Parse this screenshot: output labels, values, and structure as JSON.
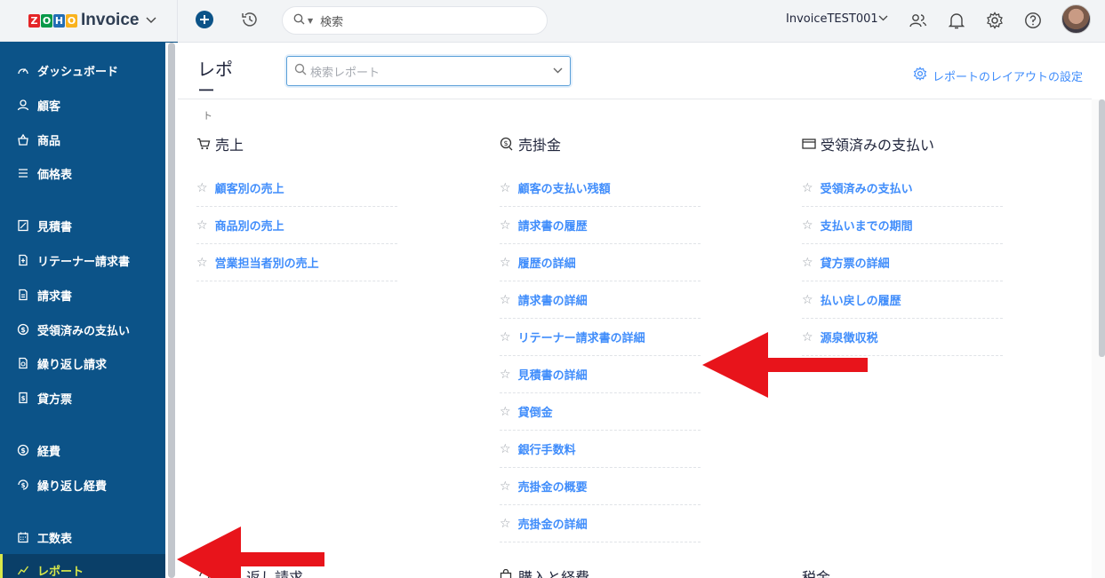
{
  "app": {
    "logo_text": "ZOHO",
    "logo_letters": [
      "Z",
      "O",
      "H",
      "O"
    ],
    "logo_colors": [
      "#e42527",
      "#089949",
      "#226db4",
      "#f9b21d"
    ],
    "name": "Invoice"
  },
  "sidebar": {
    "items": [
      {
        "label": "ダッシュボード",
        "icon": "dashboard-icon"
      },
      {
        "label": "顧客",
        "icon": "customer-icon"
      },
      {
        "label": "商品",
        "icon": "items-icon"
      },
      {
        "label": "価格表",
        "icon": "price-list-icon"
      },
      {
        "label": "見積書",
        "icon": "estimate-icon"
      },
      {
        "label": "リテーナー請求書",
        "icon": "retainer-invoice-icon"
      },
      {
        "label": "請求書",
        "icon": "invoice-icon"
      },
      {
        "label": "受領済みの支払い",
        "icon": "payments-received-icon"
      },
      {
        "label": "繰り返し請求",
        "icon": "recurring-invoice-icon"
      },
      {
        "label": "貸方票",
        "icon": "credit-note-icon"
      },
      {
        "label": "経費",
        "icon": "expense-icon"
      },
      {
        "label": "繰り返し経費",
        "icon": "recurring-expense-icon"
      },
      {
        "label": "工数表",
        "icon": "timesheet-icon"
      },
      {
        "label": "レポート",
        "icon": "reports-icon",
        "active": true
      }
    ],
    "active_color": "#d9e84a",
    "bg_color": "#0c5388"
  },
  "header": {
    "search_placeholder": "検索",
    "org_name": "InvoiceTEST001"
  },
  "main": {
    "title": "レポー",
    "title_tail": "ト",
    "report_search_placeholder": "検索レポート",
    "layout_settings_label": "レポートのレイアウトの設定",
    "link_color": "#408dfb",
    "sections": [
      {
        "title": "売上",
        "icon": "cart-icon",
        "items": [
          "顧客別の売上",
          "商品別の売上",
          "営業担当者別の売上"
        ]
      },
      {
        "title": "売掛金",
        "icon": "receivables-icon",
        "items": [
          "顧客の支払い残額",
          "請求書の履歴",
          "履歴の詳細",
          "請求書の詳細",
          "リテーナー請求書の詳細",
          "見積書の詳細",
          "貸倒金",
          "銀行手数料",
          "売掛金の概要",
          "売掛金の詳細"
        ]
      },
      {
        "title": "受領済みの支払い",
        "icon": "card-icon",
        "items": [
          "受領済みの支払い",
          "支払いまでの期間",
          "貸方票の詳細",
          "払い戻しの履歴",
          "源泉徴収税"
        ]
      }
    ],
    "bottom_sections": [
      {
        "title": "返し請求",
        "icon": "recurring-icon"
      },
      {
        "title": "購入と経費",
        "icon": "bag-icon"
      },
      {
        "title": "税金",
        "icon": "tax-icon"
      }
    ]
  },
  "annotations": {
    "arrow_color": "#e8141b"
  }
}
